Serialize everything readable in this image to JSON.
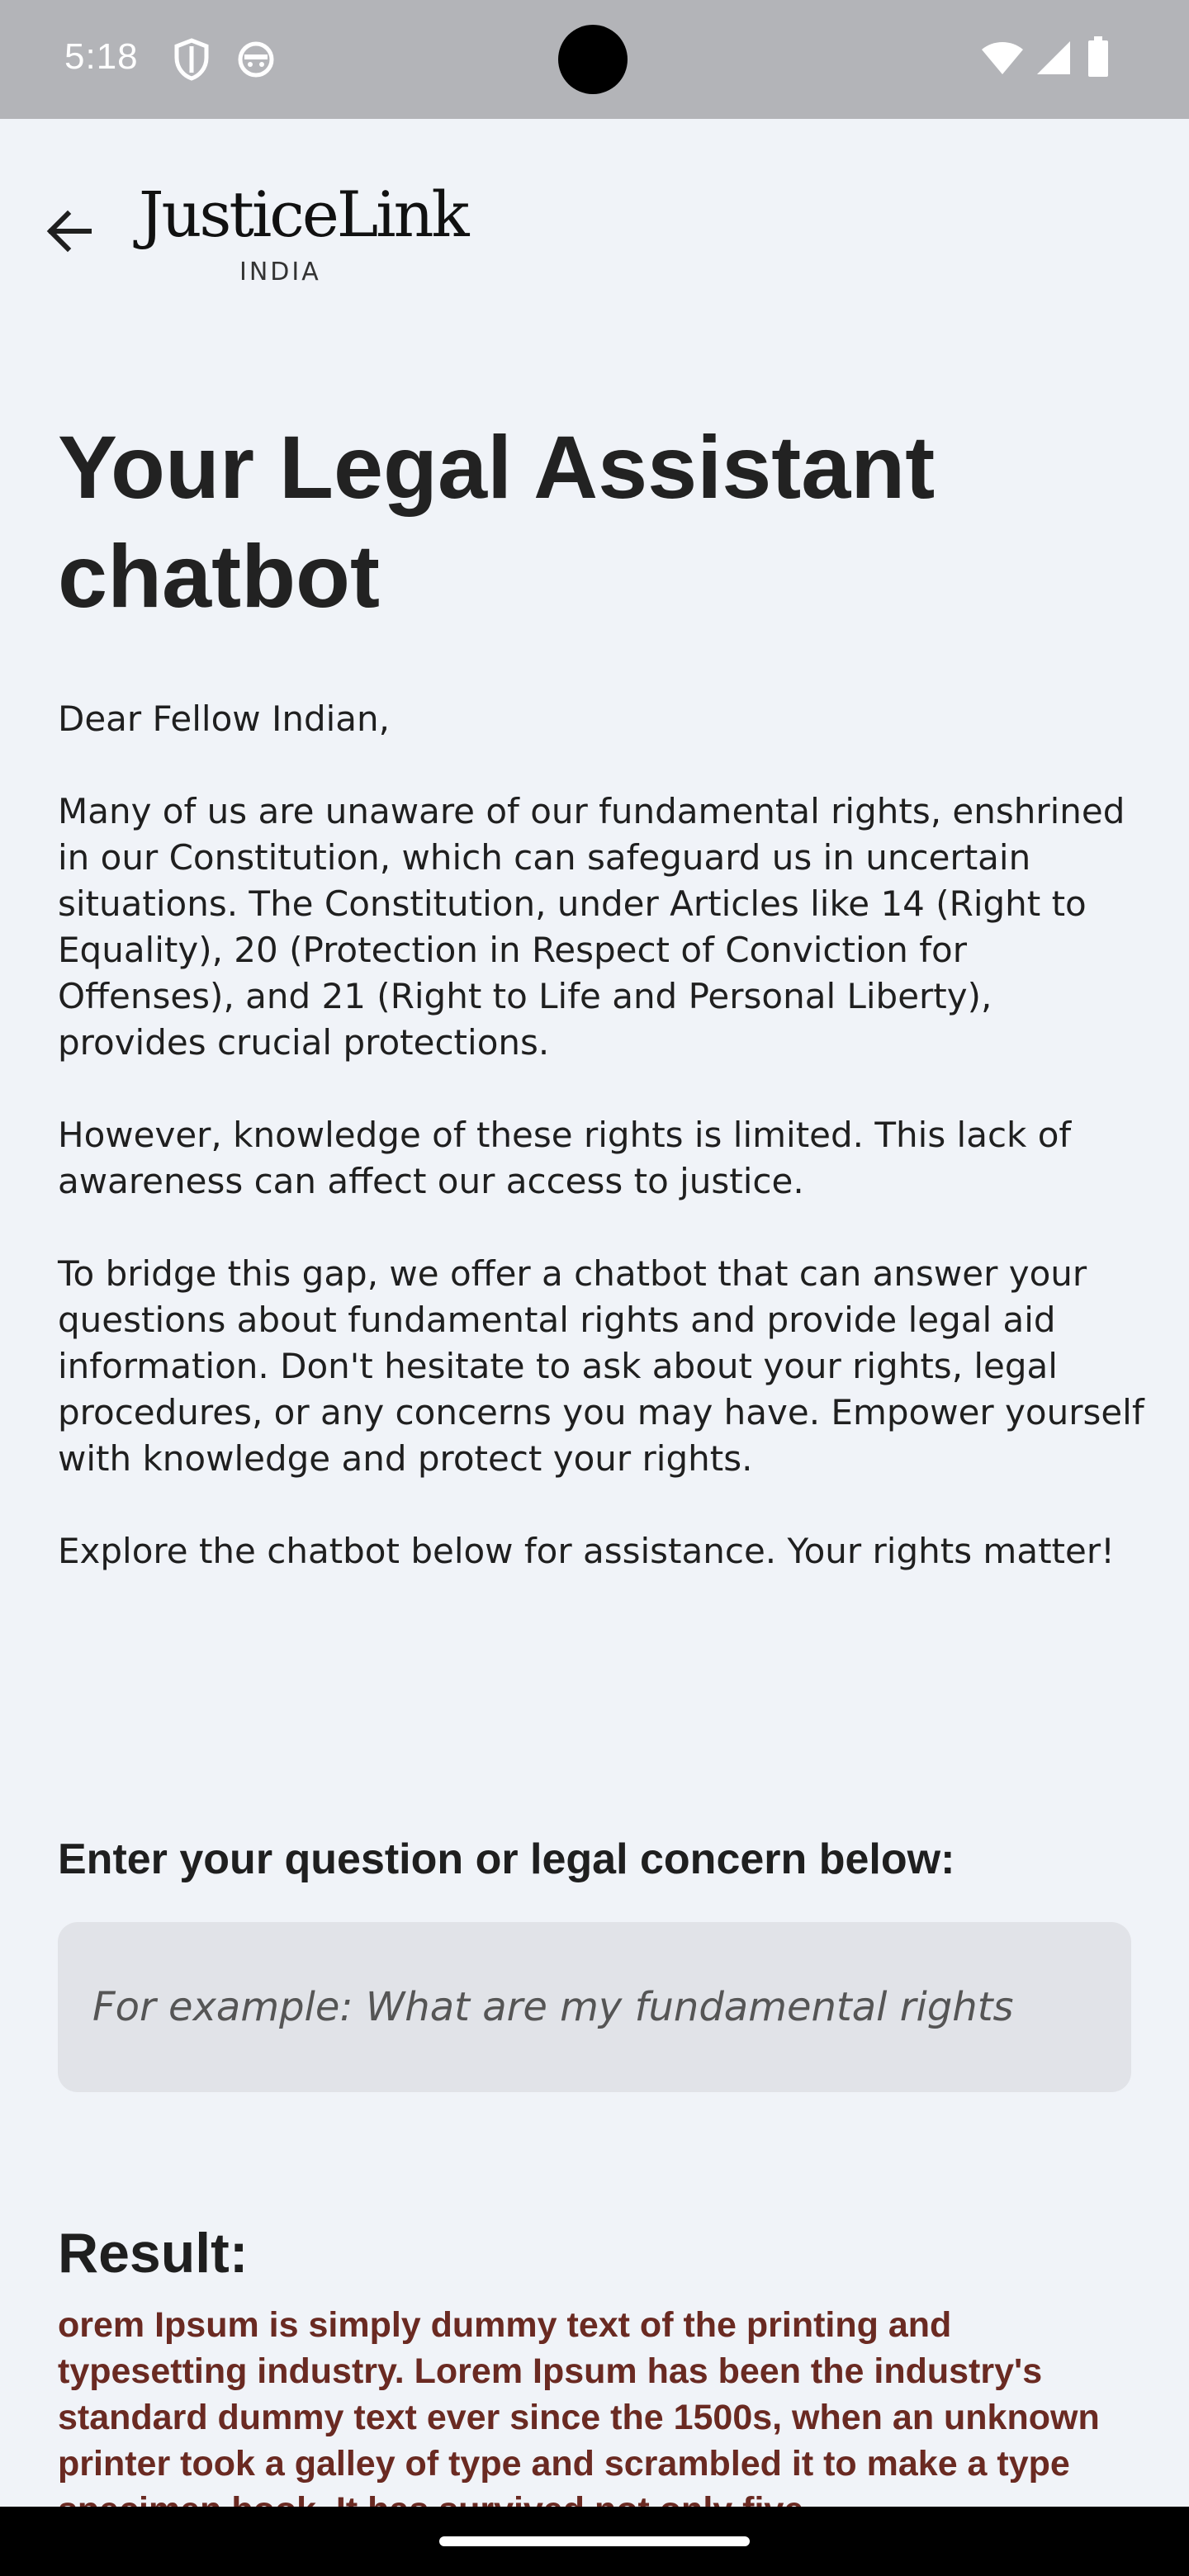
{
  "status_bar": {
    "time": "5:18",
    "icons": [
      "shield-icon",
      "android-face-icon",
      "wifi-icon",
      "signal-icon",
      "battery-icon"
    ]
  },
  "app_bar": {
    "back_icon": "arrow-left-icon",
    "logo_name": "JusticeLink",
    "logo_sub": "INDIA"
  },
  "main": {
    "title": "Your Legal Assistant chatbot",
    "intro": [
      "Dear Fellow Indian,",
      "Many of us are unaware of our fundamental rights, enshrined in our Constitution, which can safeguard us in uncertain situations. The Constitution, under Articles like 14 (Right to Equality), 20 (Protection in Respect of Conviction for Offenses), and 21 (Right to Life and Personal Liberty), provides crucial protections.",
      "However, knowledge of these rights is limited. This lack of awareness can affect our access to justice.",
      "To bridge this gap, we offer a chatbot that can answer your questions about fundamental rights and provide legal aid information. Don't hesitate to ask about your rights, legal procedures, or any concerns you may have. Empower yourself with knowledge and protect your rights.",
      "Explore the chatbot below for assistance. Your rights matter!"
    ],
    "question_label": "Enter your question or legal concern below:",
    "question_value": "",
    "question_placeholder": "For example: What are my fundamental rights",
    "result_title": "Result:",
    "result_text": "orem Ipsum is simply dummy text of the printing and typesetting industry. Lorem Ipsum has been the industry's standard dummy text ever since the 1500s, when an unknown printer took a galley of type and scrambled it to make a type specimen book. It has survived not only five"
  },
  "colors": {
    "background": "#f0f3f8",
    "status_bar": "#b3b4b8",
    "input_bg": "#e1e3e8",
    "result_text": "#6a2a22"
  }
}
